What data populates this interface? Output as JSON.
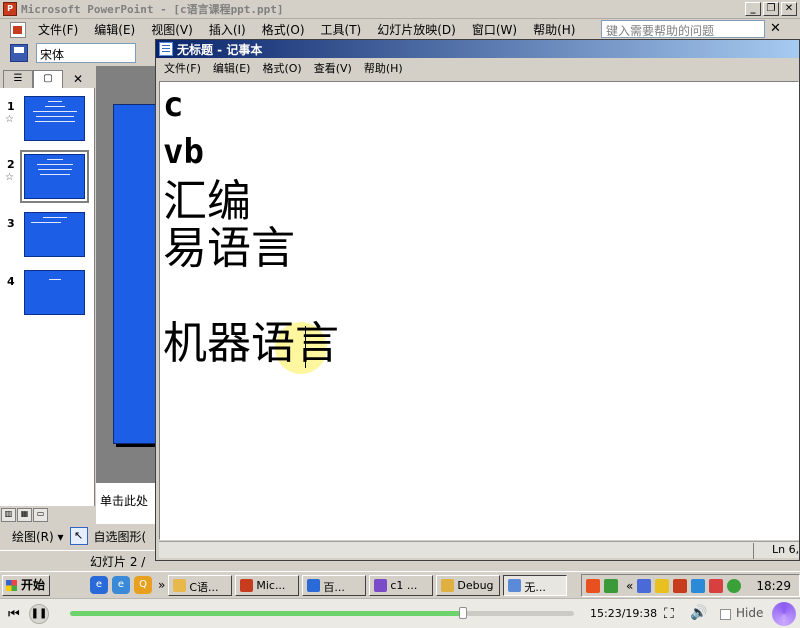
{
  "ppt": {
    "title": "Microsoft PowerPoint - [c语言课程ppt.ppt]",
    "menu": [
      "文件(F)",
      "编辑(E)",
      "视图(V)",
      "插入(I)",
      "格式(O)",
      "工具(T)",
      "幻灯片放映(D)",
      "窗口(W)",
      "帮助(H)"
    ],
    "help_placeholder": "键入需要帮助的问题",
    "font_name": "宋体",
    "slide_numbers": [
      "1",
      "2",
      "3",
      "4"
    ],
    "notes_placeholder": "单击此处",
    "draw_label": "绘图(R) ▾",
    "autoshapes_label": "自选图形(",
    "status": "幻灯片 2 /"
  },
  "notepad": {
    "title": "无标题 - 记事本",
    "menu": [
      "文件(F)",
      "编辑(E)",
      "格式(O)",
      "查看(V)",
      "帮助(H)"
    ],
    "lines": [
      "c",
      "vb",
      "汇编",
      "易语言",
      "",
      "机器语言"
    ],
    "status_position": "Ln 6,"
  },
  "taskbar": {
    "start": "开始",
    "buttons": [
      "C语...",
      "Mic...",
      "百...",
      "c1 ...",
      "Debug",
      "无..."
    ],
    "clock": "18:29",
    "colors": [
      "#e8b84a",
      "#c83c1e",
      "#2a6ad8",
      "#7a4ac8",
      "#e0b040",
      "#5a8ad8"
    ]
  },
  "player": {
    "time": "15:23/19:38",
    "progress": 0.78,
    "hide_label": "Hide"
  }
}
